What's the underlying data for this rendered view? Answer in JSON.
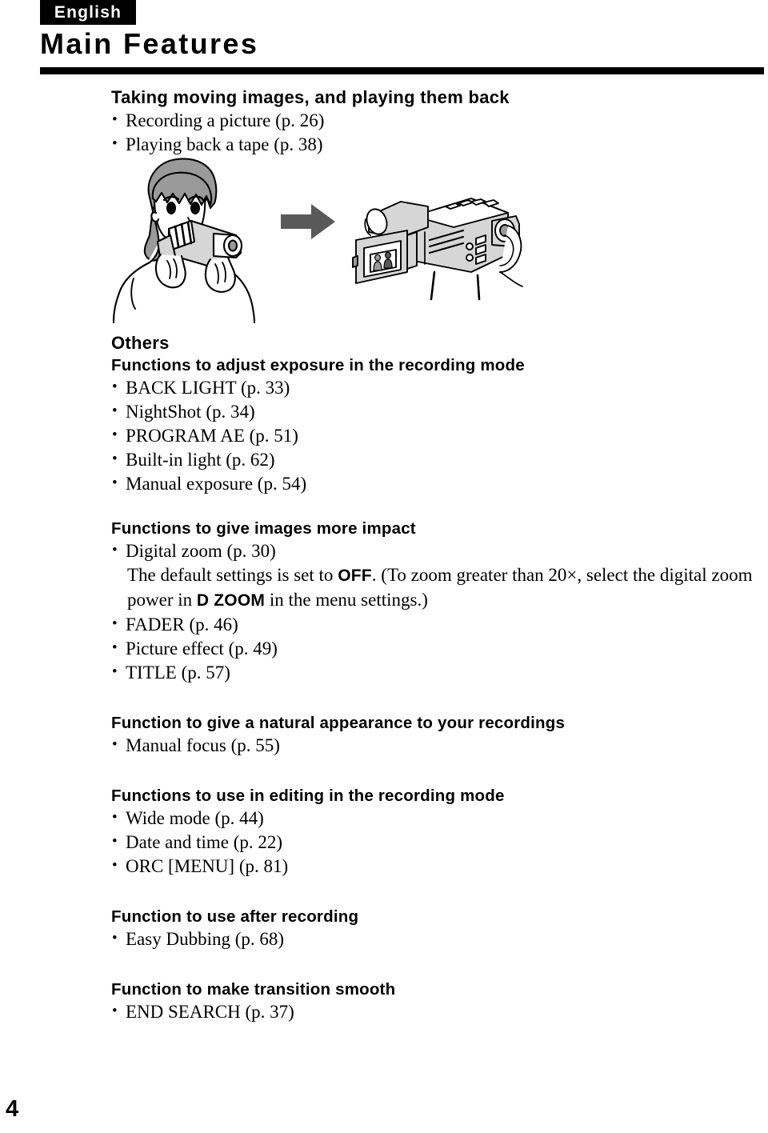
{
  "header": {
    "language_tag": "English",
    "title": "Main Features"
  },
  "intro": {
    "heading": "Taking moving images, and playing them back",
    "items": [
      "Recording a picture (p. 26)",
      "Playing back a tape (p. 38)"
    ]
  },
  "illustration": {
    "person_label": "person-recording-with-camcorder",
    "arrow_label": "right-arrow",
    "camcorder_label": "camcorder-with-open-lcd",
    "arrow_color": "#595959",
    "shade_color": "#9a9a9a",
    "light_shade_color": "#d6d6d6"
  },
  "others": {
    "heading": "Others",
    "sections": [
      {
        "heading": "Functions to adjust exposure in the recording mode",
        "items": [
          "BACK LIGHT (p. 33)",
          "NightShot (p. 34)",
          "PROGRAM AE (p. 51)",
          "Built-in light (p. 62)",
          "Manual exposure (p. 54)"
        ]
      },
      {
        "heading": "Functions to give images more impact",
        "items": [
          "Digital zoom (p. 30)"
        ],
        "note": {
          "part1": "The default settings is set to ",
          "bold1": "OFF",
          "part2": ". (To zoom greater than 20×, select the digital zoom power in ",
          "bold2": "D ZOOM",
          "part3": " in the menu settings.)"
        },
        "items_after": [
          "FADER (p. 46)",
          "Picture effect (p. 49)",
          "TITLE (p. 57)"
        ]
      },
      {
        "heading": "Function to give a natural appearance to your recordings",
        "items": [
          "Manual focus (p. 55)"
        ]
      },
      {
        "heading": "Functions to use in editing in the recording mode",
        "items": [
          "Wide mode (p. 44)",
          "Date and time (p. 22)",
          "ORC [MENU] (p. 81)"
        ]
      },
      {
        "heading": "Function to use after recording",
        "items": [
          "Easy Dubbing (p. 68)"
        ]
      },
      {
        "heading": "Function to make transition smooth",
        "items": [
          "END SEARCH (p. 37)"
        ]
      }
    ]
  },
  "footer": {
    "page_number": "4"
  }
}
